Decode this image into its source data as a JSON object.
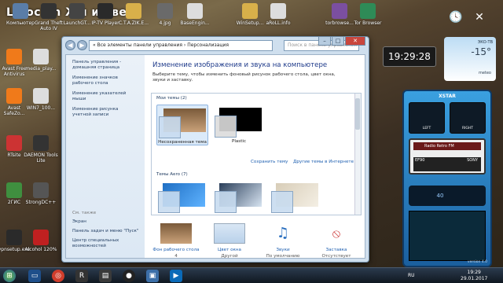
{
  "overlay_title": "Lnjockin  Жи ие ве",
  "desktop_top_icons": [
    {
      "label": "Компьютер",
      "icon": "computer-icon",
      "color": "#5a7da8"
    },
    {
      "label": "Grand Theft Auto IV",
      "icon": "gta-icon",
      "color": "#333333"
    },
    {
      "label": "LaunchGT...",
      "icon": "launcher-icon",
      "color": "#444444"
    },
    {
      "label": "IP-TV Player",
      "icon": "tv-icon",
      "color": "#2a2a2a"
    },
    {
      "label": "C.T.A.ZIK.E...",
      "icon": "folder-icon",
      "color": "#d8b04a"
    },
    {
      "label": "4.jpg",
      "icon": "image-icon",
      "color": "#6a6a6a"
    },
    {
      "label": "BaseEngin...",
      "icon": "file-icon",
      "color": "#dddddd"
    },
    {
      "label": "WinSetup...",
      "icon": "folder-icon",
      "color": "#d8b04a"
    },
    {
      "label": "aRoLL.info",
      "icon": "file-icon",
      "color": "#dddddd"
    },
    {
      "label": "torbrowse...",
      "icon": "onion-icon",
      "color": "#7b4fa0"
    },
    {
      "label": "Tor Browser",
      "icon": "onion-icon",
      "color": "#2e8b57"
    }
  ],
  "desktop_left_icons": [
    {
      "label": "Avast Free Antivirus",
      "icon": "avast-icon",
      "color": "#f07a1a"
    },
    {
      "label": "media_play...",
      "icon": "file-icon",
      "color": "#dddddd"
    },
    {
      "label": "Avast SafeZo...",
      "icon": "avast-icon",
      "color": "#f07a1a"
    },
    {
      "label": "WIN7_100...",
      "icon": "file-icon",
      "color": "#dddddd"
    },
    {
      "label": "RTsite",
      "icon": "file-icon",
      "color": "#cc3333"
    },
    {
      "label": "DAEMON Tools Lite",
      "icon": "daemon-icon",
      "color": "#333333"
    },
    {
      "label": "2ГИС",
      "icon": "map-icon",
      "color": "#3f8f3f"
    },
    {
      "label": "StrongDC++",
      "icon": "dc-icon",
      "color": "#555555"
    },
    {
      "label": "vpnsetup.exe",
      "icon": "vpn-icon",
      "color": "#2a2a2a"
    },
    {
      "label": "Alcohol 120%",
      "icon": "alcohol-icon",
      "color": "#c02020"
    }
  ],
  "window": {
    "address_path": "« Все элементы панели управления › Персонализация",
    "search_placeholder": "Поиск в панели управления",
    "sidebar": [
      "Панель управления - домашняя страница",
      "Изменение значков рабочего стола",
      "Изменение указателей мыши",
      "Изменение рисунка учетной записи"
    ],
    "see_also_heading": "См. также",
    "see_also": [
      "Экран",
      "Панель задач и меню \"Пуск\"",
      "Центр специальных возможностей"
    ],
    "heading": "Изменение изображения и звука на компьютере",
    "description": "Выберите тему, чтобы изменить фоновый рисунок рабочего стола, цвет окна, звуки и заставку.",
    "my_themes_label": "Мои темы (2)",
    "my_themes": [
      "Несохраненная тема",
      "Plastic"
    ],
    "save_theme": "Сохранить тему",
    "more_themes": "Другие темы в Интернете",
    "aero_label": "Темы Aero (7)",
    "bottom_items": [
      {
        "name": "Фон рабочего стола",
        "value": "4"
      },
      {
        "name": "Цвет окна",
        "value": "Другой"
      },
      {
        "name": "Звуки",
        "value": "По умолчанию"
      },
      {
        "name": "Заставка",
        "value": "Отсутствует"
      }
    ]
  },
  "clock_widget": "19:29:28",
  "weather_widget": {
    "location": "ЭКО-ТВ",
    "temp": "-15°",
    "source": "meteo"
  },
  "xstar": {
    "brand": "XSTAR",
    "left": "LEFT",
    "right": "RIGHT",
    "radio": "Radio Retro FM",
    "tape_left": "EF90",
    "tape_right": "SONY",
    "volume": "40",
    "version": "version 4.0"
  },
  "taskbar": {
    "lang": "RU",
    "time": "19:29",
    "date": "29.01.2017"
  }
}
